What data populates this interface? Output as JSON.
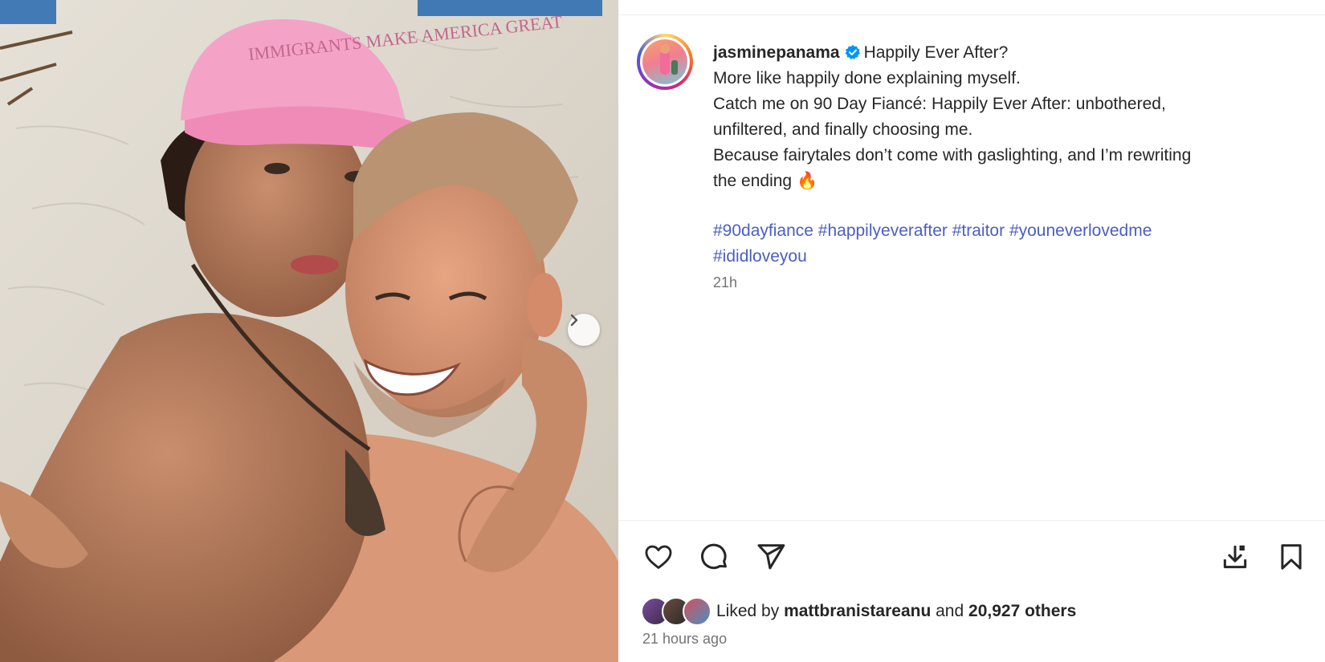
{
  "post": {
    "username": "jasminepanama",
    "caption_title": "Happily Ever After?",
    "caption_lines": [
      "More like happily done explaining myself.",
      "Catch me on 90 Day Fiancé: Happily Ever After: unbothered,",
      "unfiltered, and finally choosing me.",
      "Because fairytales don’t come with gaslighting, and I’m rewriting",
      "the ending"
    ],
    "caption_emoji": "🔥",
    "hashtags": [
      "#90dayfiance",
      "#happilyeverafter",
      "#traitor",
      "#youneverlovedme",
      "#ididloveyou"
    ],
    "caption_age": "21h",
    "likes": {
      "prefix": "Liked by",
      "user": "mattbranistareanu",
      "middle": "and",
      "count": "20,927 others"
    },
    "post_age": "21 hours ago",
    "photo_cap_text": "IMMIGRANTS MAKE AMERICA GREAT"
  },
  "colors": {
    "hashtag": "#4a5fc1",
    "verified": "#0095f6",
    "cap": "#f4a3c7",
    "sand": "#d9d3c8"
  },
  "icons": {
    "like": "heart-icon",
    "comment": "comment-icon",
    "share": "send-icon",
    "save_to_device": "download-icon",
    "bookmark": "bookmark-icon",
    "carousel_next": "chevron-right-icon"
  }
}
